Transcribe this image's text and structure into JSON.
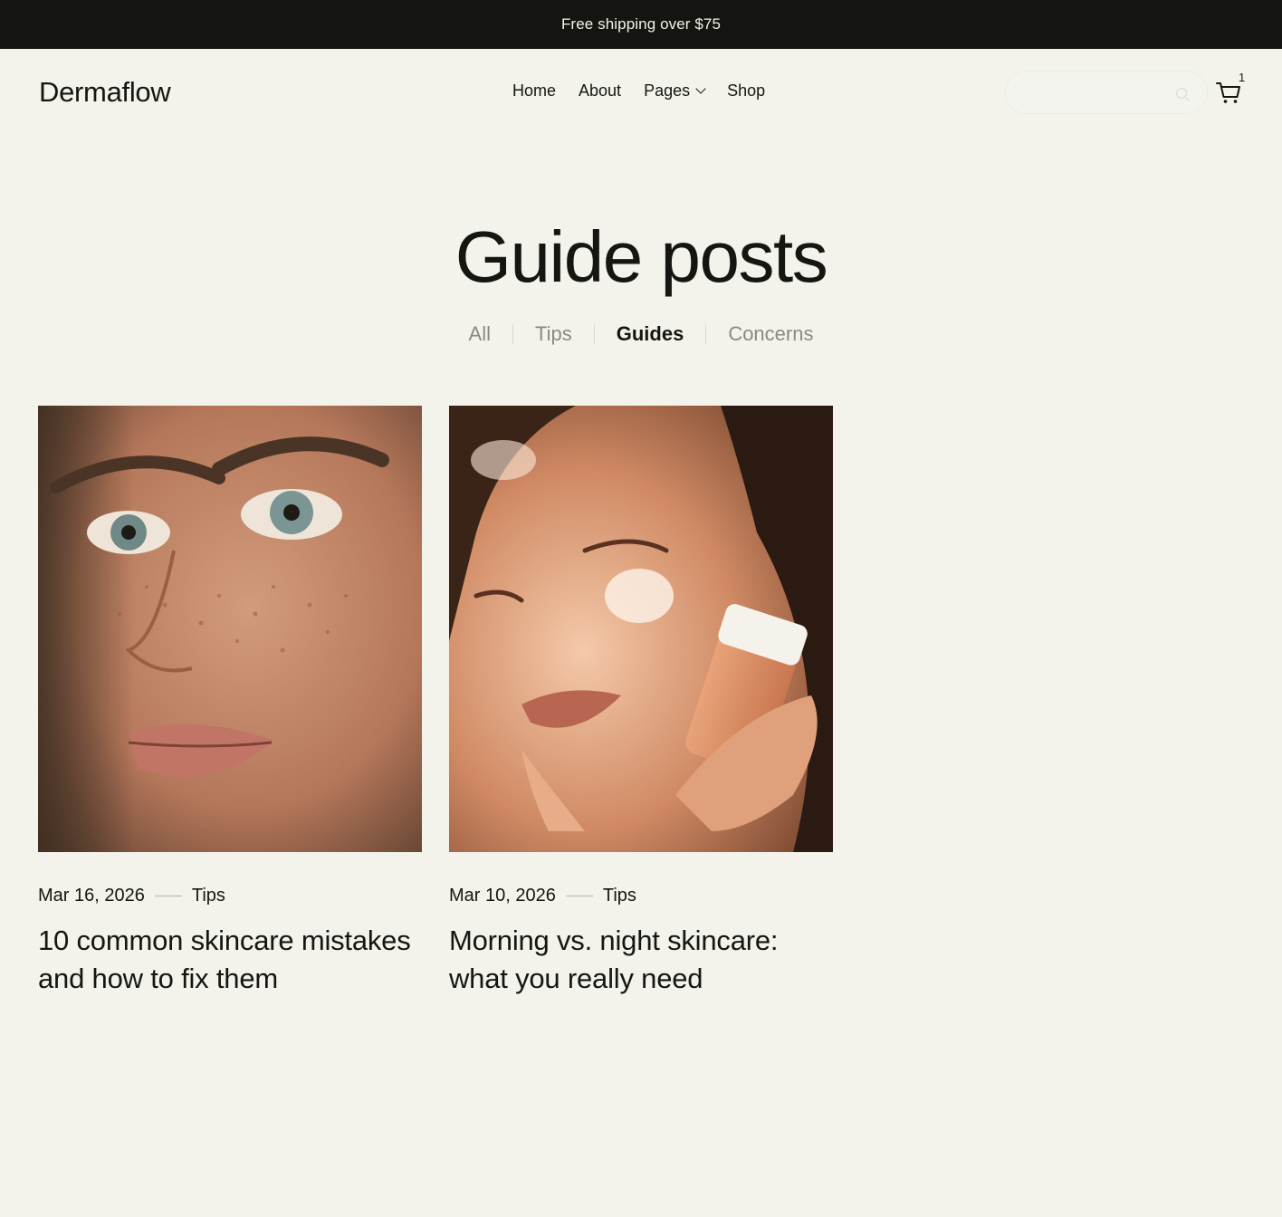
{
  "announcement": {
    "text": "Free shipping over $75"
  },
  "brand": {
    "name": "Dermaflow"
  },
  "nav": {
    "items": [
      {
        "label": "Home"
      },
      {
        "label": "About"
      },
      {
        "label": "Pages"
      },
      {
        "label": "Shop"
      }
    ]
  },
  "search": {
    "placeholder": ""
  },
  "cart": {
    "count": "1"
  },
  "page": {
    "title": "Guide posts"
  },
  "filters": {
    "items": [
      {
        "label": "All",
        "active": false
      },
      {
        "label": "Tips",
        "active": false
      },
      {
        "label": "Guides",
        "active": true
      },
      {
        "label": "Concerns",
        "active": false
      }
    ]
  },
  "posts": [
    {
      "date": "Mar 16, 2026",
      "category": "Tips",
      "title": "10 common skincare mistakes and how to fix them",
      "image": "freckled-face-closeup"
    },
    {
      "date": "Mar 10, 2026",
      "category": "Tips",
      "title": "Morning vs. night skincare: what you really need",
      "image": "woman-applying-cream"
    }
  ],
  "colors": {
    "background": "#f3f3ec",
    "announcement_bg": "#141411",
    "text": "#151512",
    "muted": "#8a8a84"
  }
}
